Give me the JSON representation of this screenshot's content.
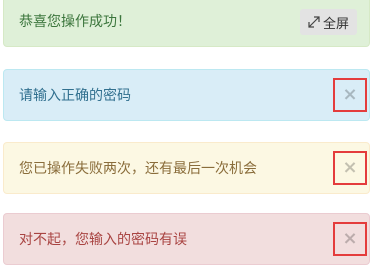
{
  "alerts": {
    "success": {
      "text": "恭喜您操作成功！",
      "fullscreen_label": "全屏"
    },
    "info": {
      "text": "请输入正确的密码",
      "close": "×"
    },
    "warning": {
      "text": "您已操作失败两次，还有最后一次机会",
      "close": "×"
    },
    "danger": {
      "text": "对不起，您输入的密码有误",
      "close": "×"
    }
  },
  "colors": {
    "success_bg": "#dff0d8",
    "info_bg": "#d9edf7",
    "warning_bg": "#fcf8e3",
    "danger_bg": "#f2dede",
    "highlight_border": "#e43c3c"
  }
}
